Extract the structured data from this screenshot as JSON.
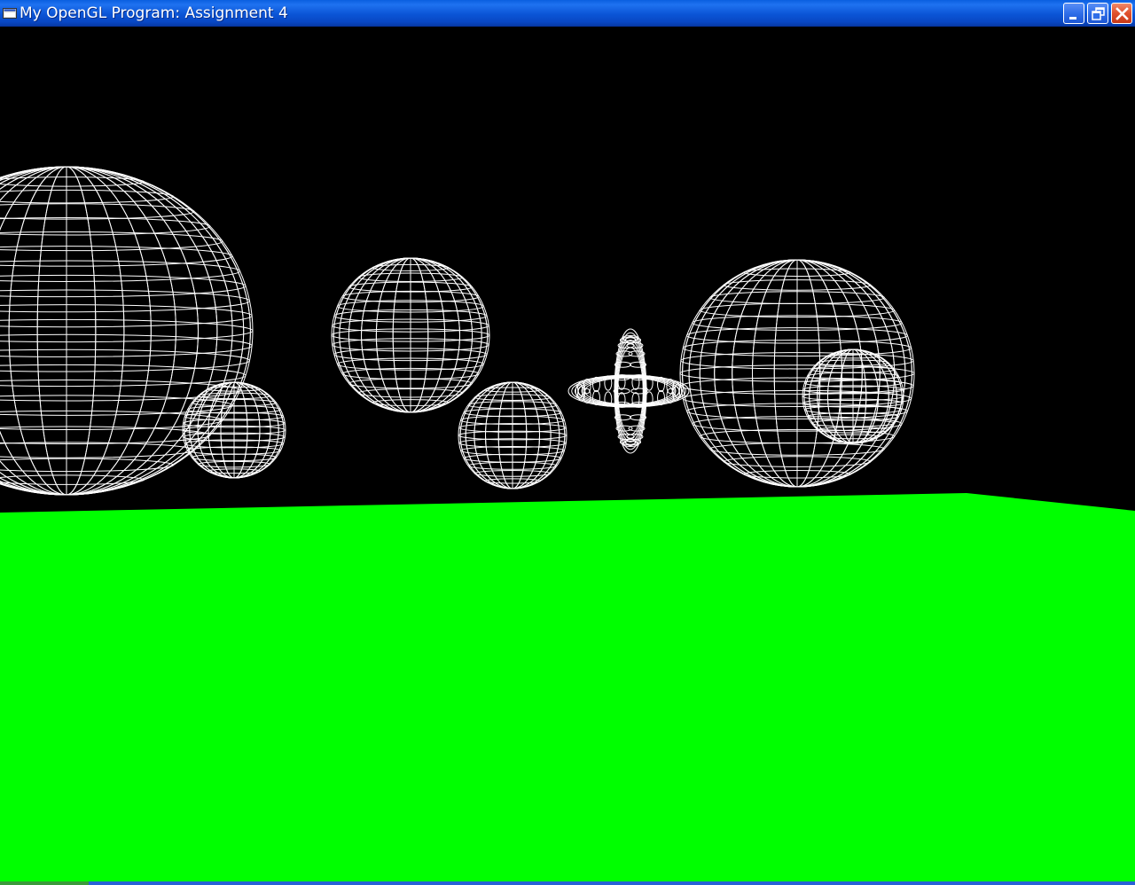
{
  "window": {
    "title": "My OpenGL Program: Assignment 4",
    "controls": {
      "minimize_icon": "minimize-icon",
      "restore_icon": "restore-icon",
      "close_icon": "close-icon"
    }
  },
  "scene": {
    "background_color": "#000000",
    "ground_color": "#00ff00",
    "wire_color": "#ffffff",
    "objects": [
      "large-sphere-left",
      "small-sphere-left",
      "upper-sphere-center",
      "lower-sphere-center",
      "wire-torus-horizontal",
      "wire-torus-vertical",
      "large-sphere-right",
      "small-sphere-right"
    ]
  },
  "colors": {
    "titlebar": "#0b55d6",
    "close_button": "#e0502c"
  }
}
